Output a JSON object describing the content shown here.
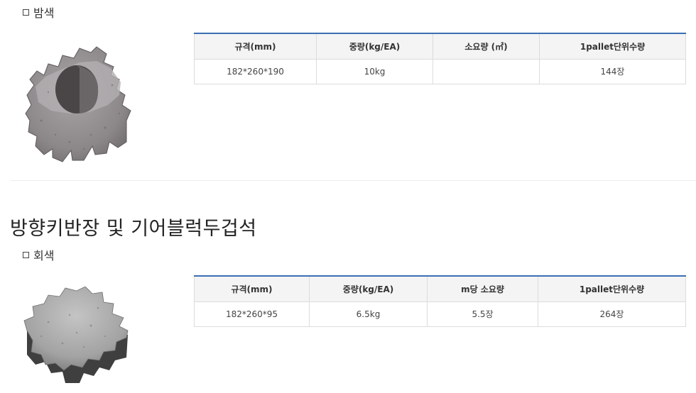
{
  "section1": {
    "color_label": "밤색",
    "product_image": "paving-block-chestnut",
    "table": {
      "headers": [
        "규격(mm)",
        "중량(kg/EA)",
        "소요량 (㎡)",
        "1pallet단위수량"
      ],
      "rows": [
        [
          "182*260*190",
          "10kg",
          "",
          "144장"
        ]
      ]
    }
  },
  "section2": {
    "title": "방향키반장 및 기어블럭두겁석",
    "color_label": "회색",
    "product_image": "gear-block-cap-gray",
    "table": {
      "headers": [
        "규격(mm)",
        "중량(kg/EA)",
        "m당 소요량",
        "1pallet단위수량"
      ],
      "rows": [
        [
          "182*260*95",
          "6.5kg",
          "5.5장",
          "264장"
        ]
      ]
    }
  },
  "colors": {
    "table_accent": "#3b6fb5",
    "header_bg": "#f4f4f4",
    "chestnut_block": "#8f8a8c",
    "gray_block": "#a6a6a6"
  }
}
